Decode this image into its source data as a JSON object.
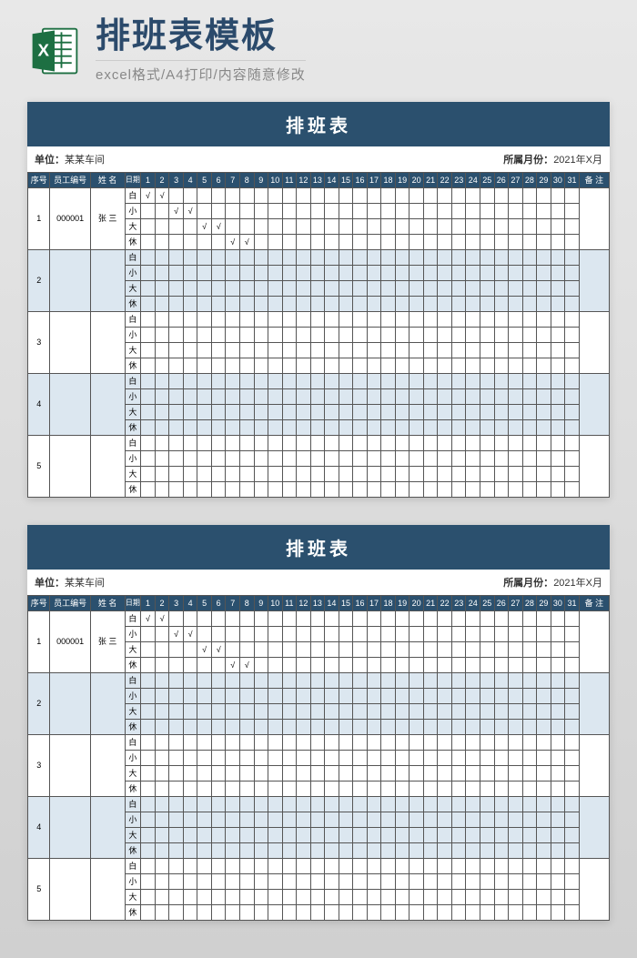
{
  "header": {
    "main_title": "排班表模板",
    "subtitle": "excel格式/A4打印/内容随意修改"
  },
  "sheet": {
    "title": "排班表",
    "unit_label": "单位：",
    "unit_value": "某某车间",
    "month_label": "所属月份：",
    "month_value": "2021年X月",
    "columns": {
      "seq": "序号",
      "emp_id": "员工编号",
      "name": "姓 名",
      "date_label": "日期",
      "note": "备 注"
    },
    "days": [
      "1",
      "2",
      "3",
      "4",
      "5",
      "6",
      "7",
      "8",
      "9",
      "10",
      "11",
      "12",
      "13",
      "14",
      "15",
      "16",
      "17",
      "18",
      "19",
      "20",
      "21",
      "22",
      "23",
      "24",
      "25",
      "26",
      "27",
      "28",
      "29",
      "30",
      "31"
    ],
    "shifts": [
      "白",
      "小",
      "大",
      "休"
    ],
    "rows": [
      {
        "seq": "1",
        "emp_id": "000001",
        "name": "张 三",
        "alt": false,
        "marks": {
          "白": [
            1,
            2
          ],
          "小": [
            3,
            4
          ],
          "大": [
            5,
            6
          ],
          "休": [
            7,
            8
          ]
        }
      },
      {
        "seq": "2",
        "emp_id": "",
        "name": "",
        "alt": true,
        "marks": {}
      },
      {
        "seq": "3",
        "emp_id": "",
        "name": "",
        "alt": false,
        "marks": {}
      },
      {
        "seq": "4",
        "emp_id": "",
        "name": "",
        "alt": true,
        "marks": {}
      },
      {
        "seq": "5",
        "emp_id": "",
        "name": "",
        "alt": false,
        "marks": {}
      }
    ],
    "check_mark": "√"
  }
}
